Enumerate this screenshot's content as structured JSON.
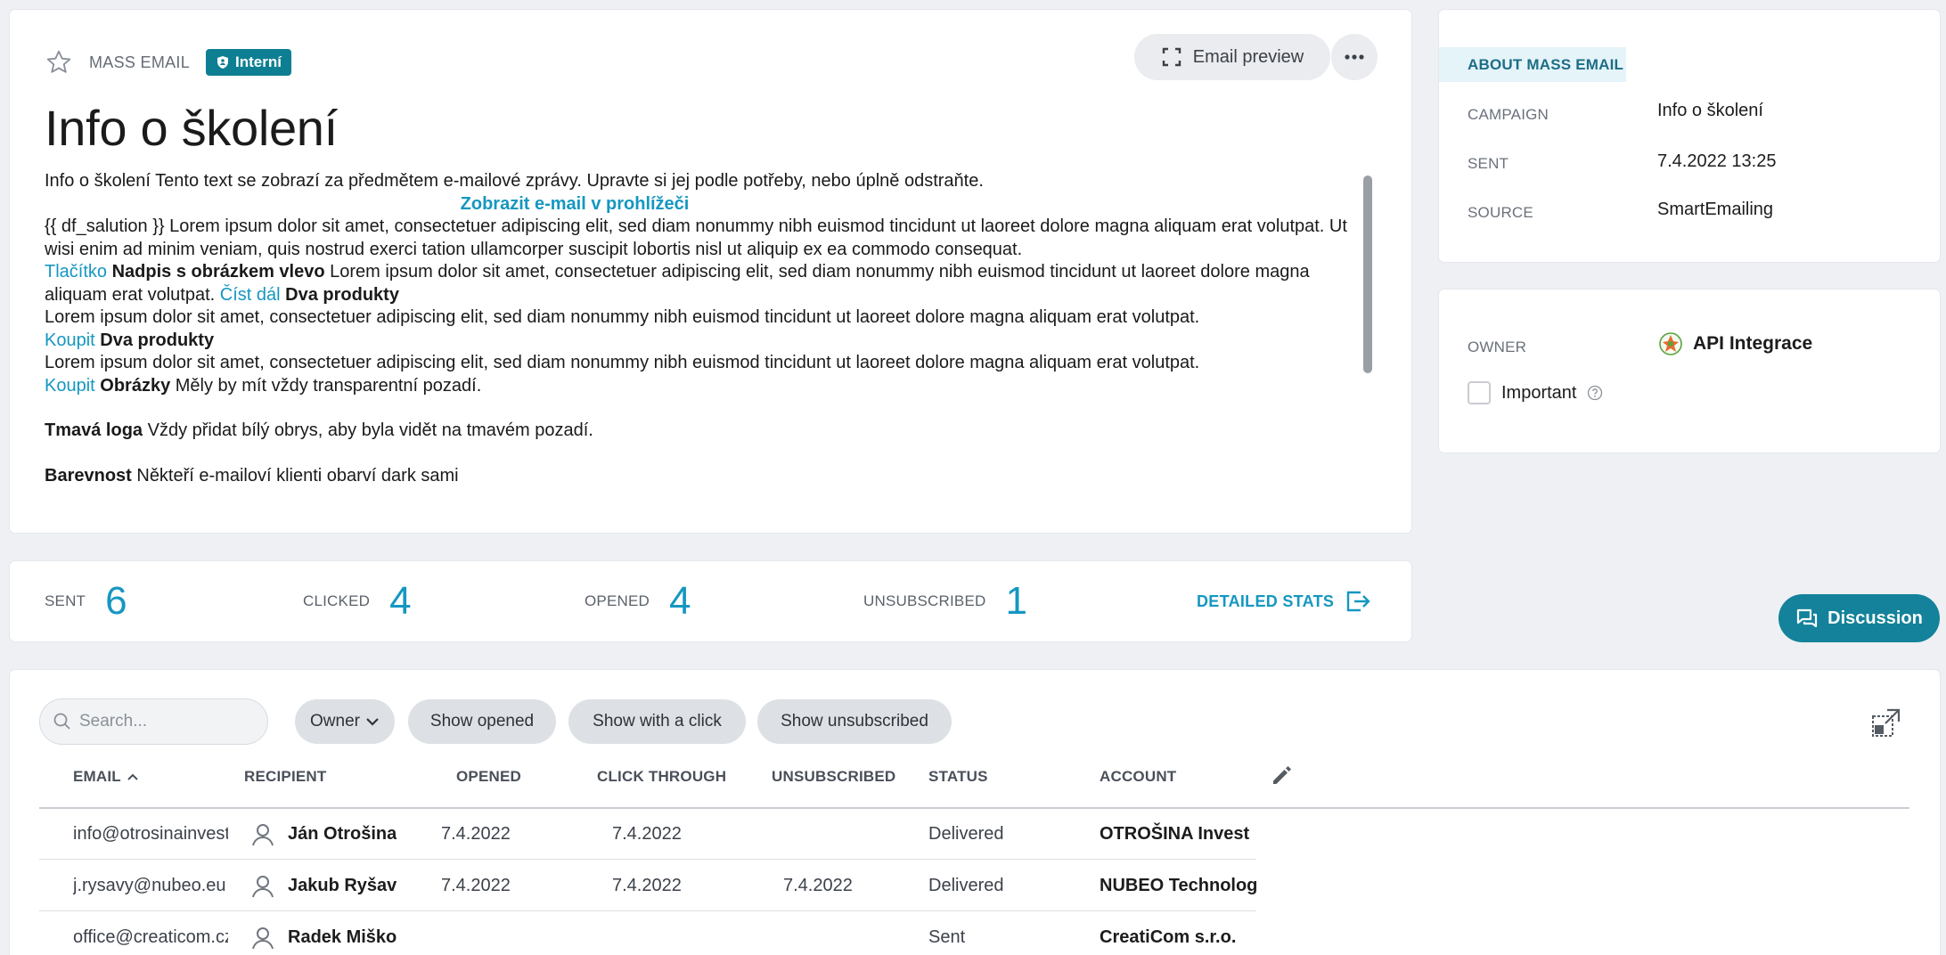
{
  "header": {
    "type_label": "MASS EMAIL",
    "badge": "Interní",
    "preview_button": "Email preview",
    "title": "Info o školení"
  },
  "email_body": {
    "line1": "Info o školení Tento text se zobrazí za předmětem e-mailové zprávy. Upravte si jej podle potřeby, nebo úplně odstraňte.",
    "view_in_browser": "Zobrazit e-mail v prohlížeči",
    "para1": "{{ df_salution }} Lorem ipsum dolor sit amet, consectetuer adipiscing elit, sed diam nonummy nibh euismod tincidunt ut laoreet dolore magna aliquam erat volutpat. Ut wisi enim ad minim veniam, quis nostrud exerci tation ullamcorper suscipit lobortis nisl ut aliquip ex ea commodo consequat.",
    "button_link": "Tlačítko",
    "heading_image_left": "Nadpis s obrázkem vlevo",
    "para2": " Lorem ipsum dolor sit amet, consectetuer adipiscing elit, sed diam nonummy nibh euismod tincidunt ut laoreet dolore magna aliquam erat volutpat. ",
    "read_more": "Číst dál",
    "two_products_1": "Dva produkty",
    "lorem_short_1": "Lorem ipsum dolor sit amet, consectetuer adipiscing elit, sed diam nonummy nibh euismod tincidunt ut laoreet dolore magna aliquam erat volutpat.",
    "buy_1": "Koupit",
    "two_products_2": "Dva produkty",
    "lorem_short_2": "Lorem ipsum dolor sit amet, consectetuer adipiscing elit, sed diam nonummy nibh euismod tincidunt ut laoreet dolore magna aliquam erat volutpat.",
    "buy_2": "Koupit",
    "images_heading": "Obrázky",
    "images_text": " Měly by mít vždy transparentní pozadí.",
    "dark_logos_heading": "Tmavá loga",
    "dark_logos_text": " Vždy přidat bílý obrys, aby byla vidět na tmavém pozadí.",
    "colors_heading": "Barevnost",
    "colors_text": " Někteří e-mailoví klienti obarví dark sami"
  },
  "about": {
    "tab": "ABOUT MASS EMAIL",
    "campaign_label": "CAMPAIGN",
    "campaign_value": "Info o školení",
    "sent_label": "SENT",
    "sent_value": "7.4.2022 13:25",
    "source_label": "SOURCE",
    "source_value": "SmartEmailing"
  },
  "owner": {
    "label": "OWNER",
    "value": "API Integrace",
    "important_label": "Important"
  },
  "stats": {
    "sent_label": "SENT",
    "sent_value": "6",
    "clicked_label": "CLICKED",
    "clicked_value": "4",
    "opened_label": "OPENED",
    "opened_value": "4",
    "unsubscribed_label": "UNSUBSCRIBED",
    "unsubscribed_value": "1",
    "detailed_label": "DETAILED STATS"
  },
  "discussion_button": "Discussion",
  "toolbar": {
    "search_placeholder": "Search...",
    "owner_filter": "Owner",
    "show_opened": "Show opened",
    "show_with_click": "Show with a click",
    "show_unsubscribed": "Show unsubscribed"
  },
  "table": {
    "columns": [
      "EMAIL",
      "RECIPIENT",
      "OPENED",
      "CLICK THROUGH",
      "UNSUBSCRIBED",
      "STATUS",
      "ACCOUNT"
    ],
    "rows": [
      {
        "email": "info@otrosinainvest.cz",
        "recipient": "Ján Otrošina",
        "opened": "7.4.2022",
        "click": "7.4.2022",
        "unsub": "",
        "status": "Delivered",
        "account": "OTROŠINA Invest"
      },
      {
        "email": "j.rysavy@nubeo.eu",
        "recipient": "Jakub Ryšavý",
        "opened": "7.4.2022",
        "click": "7.4.2022",
        "unsub": "7.4.2022",
        "status": "Delivered",
        "account": "NUBEO Technologies"
      },
      {
        "email": "office@creaticom.cz",
        "recipient": "Radek Miškovský",
        "opened": "",
        "click": "",
        "unsub": "",
        "status": "Sent",
        "account": "CreatiCom s.r.o."
      }
    ]
  },
  "colors": {
    "accent": "#1597c1",
    "badge": "#0e7f93",
    "discussion": "#13829a",
    "background": "#eef0f3"
  },
  "icons": [
    "star-icon",
    "shield-icon",
    "fullscreen-icon",
    "more-icon",
    "owner-avatar-icon",
    "help-icon",
    "export-icon",
    "chat-icon",
    "search-icon",
    "chevron-down-icon",
    "sort-up-icon",
    "pencil-icon",
    "expand-icon",
    "user-icon"
  ]
}
